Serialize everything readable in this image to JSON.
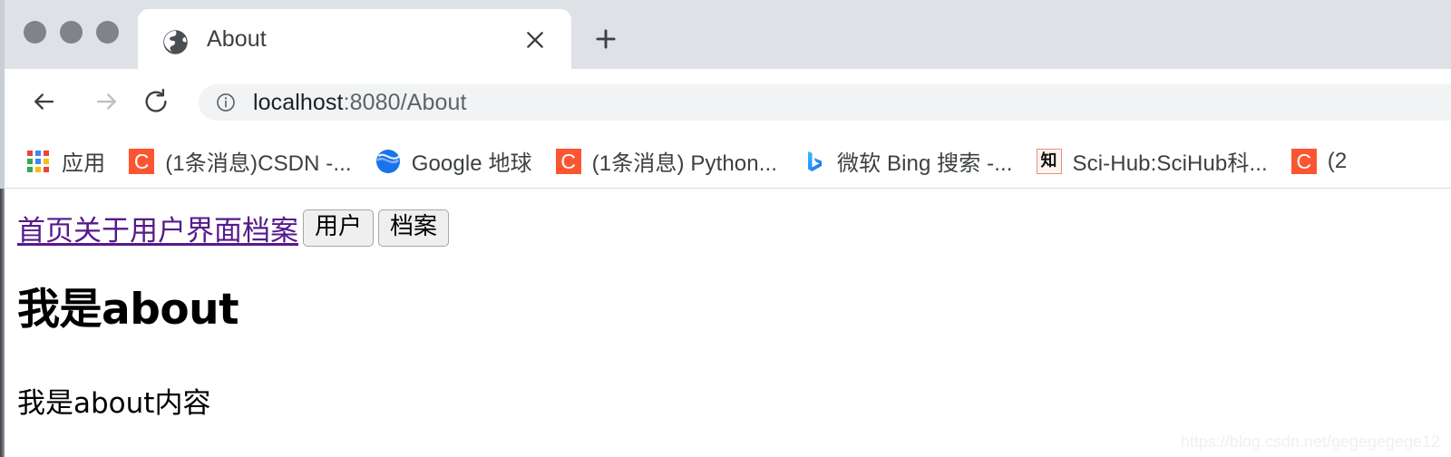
{
  "browser": {
    "window_controls": [
      "close",
      "minimize",
      "maximize"
    ],
    "tab": {
      "title": "About",
      "favicon": "globe-icon",
      "close_label": "×"
    },
    "new_tab_label": "+",
    "toolbar": {
      "back_icon": "arrow-left-icon",
      "forward_icon": "arrow-right-icon",
      "reload_icon": "reload-icon",
      "security_icon": "info-circle-icon",
      "url_host": "localhost",
      "url_path": ":8080/About",
      "url_full": "localhost:8080/About"
    },
    "bookmarks": [
      {
        "label": "应用",
        "icon": "apps-grid-icon"
      },
      {
        "label": "(1条消息)CSDN -...",
        "icon": "csdn-icon"
      },
      {
        "label": "Google 地球",
        "icon": "google-earth-icon"
      },
      {
        "label": "(1条消息) Python...",
        "icon": "csdn-icon"
      },
      {
        "label": "微软 Bing 搜索 -...",
        "icon": "bing-icon"
      },
      {
        "label": "Sci-Hub:SciHub科...",
        "icon": "zhihu-icon"
      },
      {
        "label": "(2",
        "icon": "csdn-icon"
      }
    ]
  },
  "page": {
    "nav_links_text": "首页关于用户界面档案",
    "buttons": [
      {
        "label": "用户"
      },
      {
        "label": "档案"
      }
    ],
    "heading": "我是about",
    "body_text": "我是about内容",
    "watermark": "https://blog.csdn.net/gegegegege12"
  },
  "colors": {
    "tab_strip_bg": "#dee1e6",
    "toolbar_bg": "#ffffff",
    "omnibox_bg": "#f1f3f4",
    "visited_link": "#551a8b",
    "csdn_red": "#fc5531",
    "text_primary": "#202124",
    "text_secondary": "#5f6368"
  }
}
